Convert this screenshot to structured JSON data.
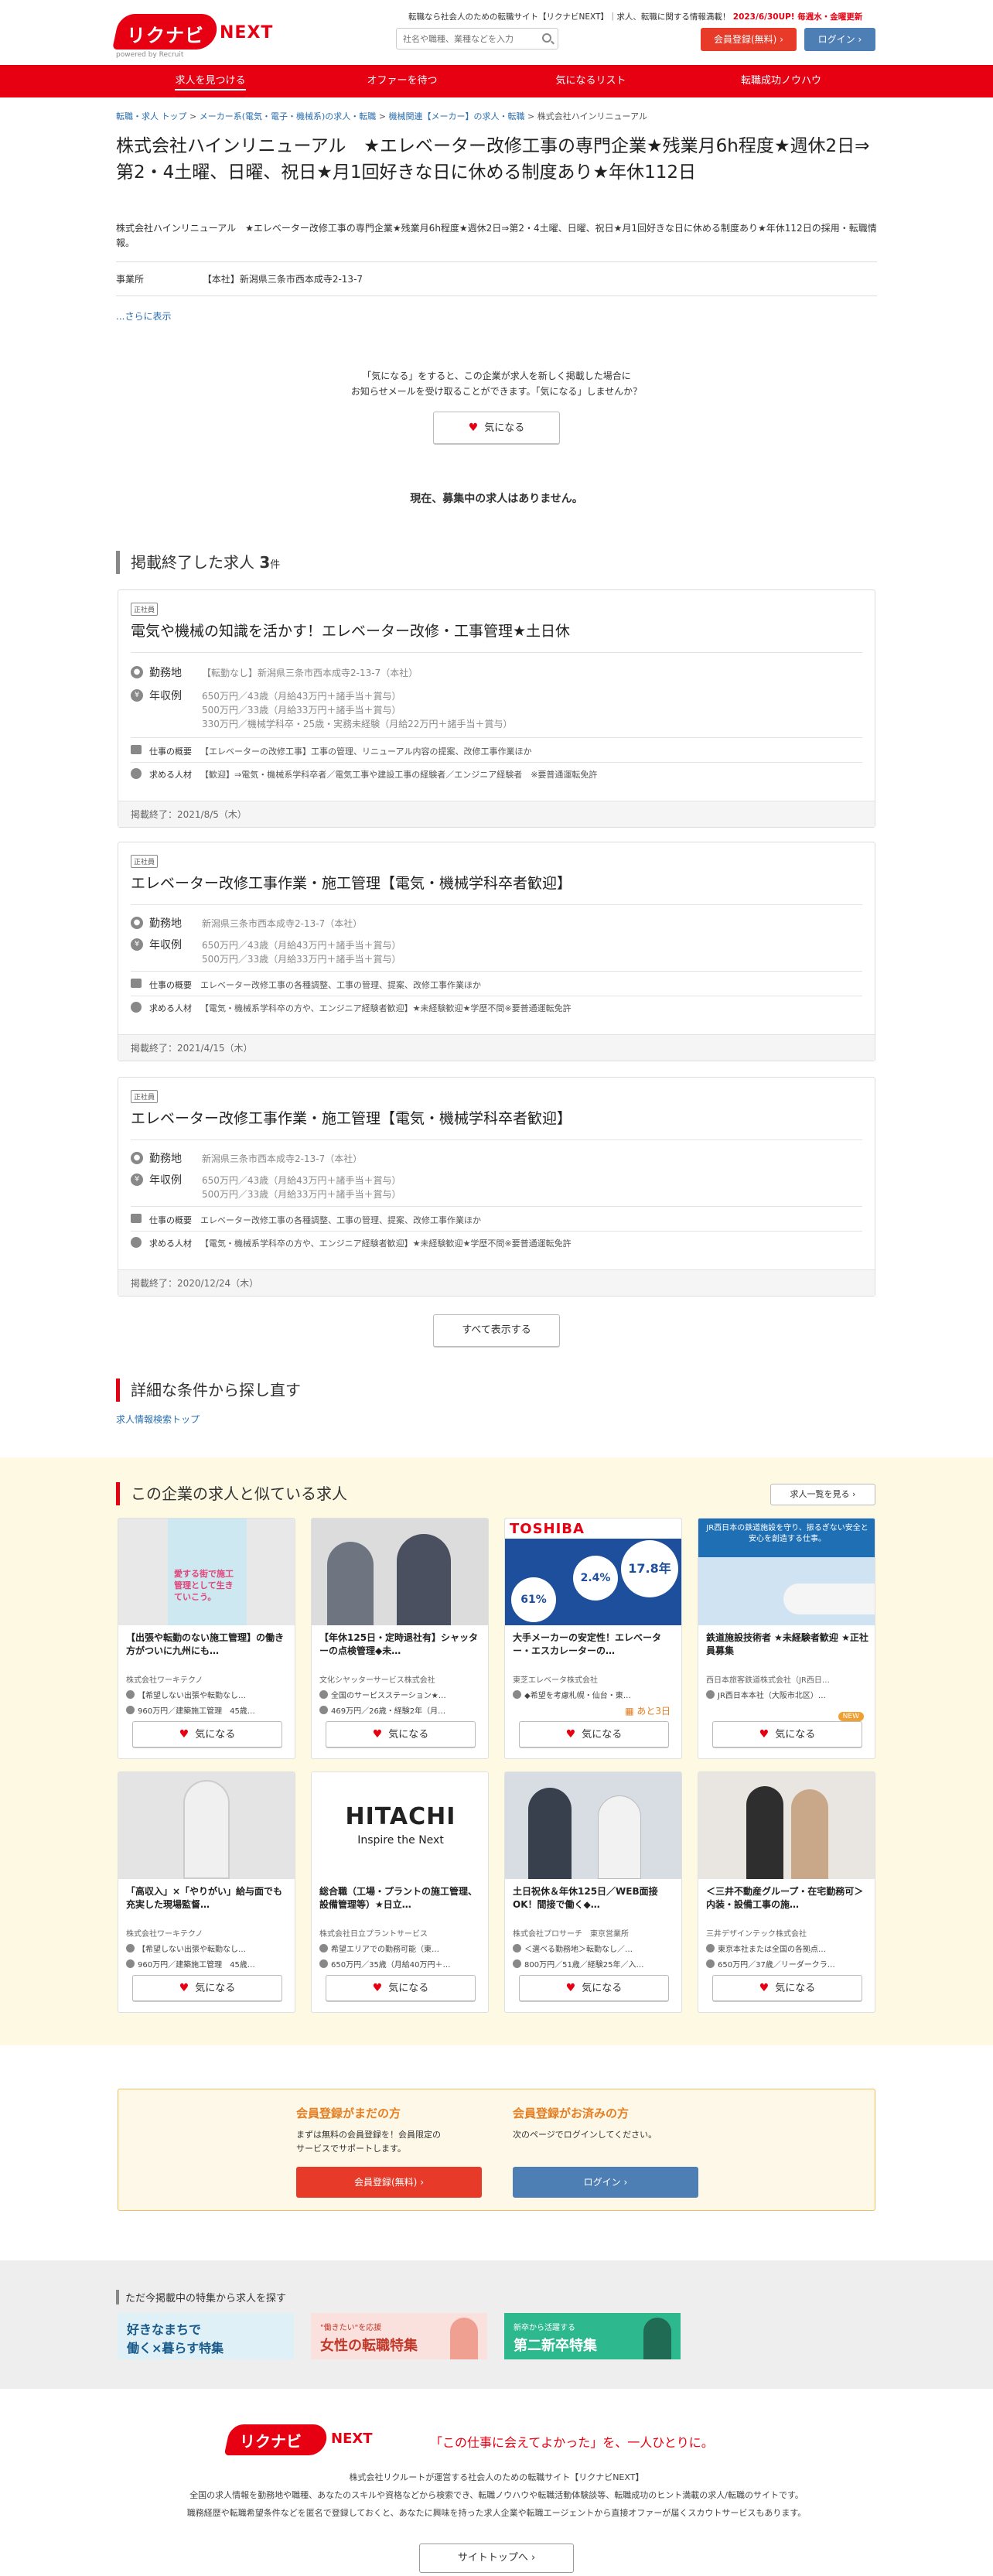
{
  "header": {
    "logo_text": "リクナビ",
    "logo_next": "NEXT",
    "logo_sub": "powered by Recruit",
    "tagline_1": "転職なら社会人のための転職サイト【リクナビNEXT】｜求人、転職に関する情報満載！",
    "tagline_2": "2023/6/30UP! 毎週水・金曜更新",
    "search_placeholder": "社名や職種、業種などを入力",
    "register_label": "会員登録(無料)",
    "login_label": "ログイン"
  },
  "nav": [
    "求人を見つける",
    "オファーを待つ",
    "気になるリスト",
    "転職成功ノウハウ"
  ],
  "breadcrumb": [
    "転職・求人 トップ",
    "メーカー系(電気・電子・機械系)の求人・転職",
    "機械関連【メーカー】の求人・転職",
    "株式会社ハインリニューアル"
  ],
  "company": {
    "title": "株式会社ハインリニューアル　★エレベーター改修工事の専門企業★残業月6h程度★週休2日⇒第2・4土曜、日曜、祝日★月1回好きな日に休める制度あり★年休112日",
    "sub": "株式会社ハインリニューアル　★エレベーター改修工事の専門企業★残業月6h程度★週休2日⇒第2・4土曜、日曜、祝日★月1回好きな日に休める制度あり★年休112日の採用・転職情報。",
    "office_label": "事業所",
    "office_value": "【本社】新潟県三条市西本成寺2-13-7",
    "more": "...さらに表示"
  },
  "favorite": {
    "note_1": "「気になる」をすると、この企業が求人を新しく掲載した場合に",
    "note_2": "お知らせメールを受け取ることができます。「気になる」しませんか？",
    "button": "気になる",
    "no_jobs": "現在、募集中の求人はありません。"
  },
  "ended": {
    "heading": "掲載終了した求人",
    "count": "3",
    "count_unit": "件",
    "labels": {
      "location": "勤務地",
      "salary": "年収例",
      "work": "仕事の概要",
      "want": "求める人材"
    },
    "jobs": [
      {
        "tag": "正社員",
        "title": "電気や機械の知識を活かす！エレベーター改修・工事管理★土日休",
        "location": "【転勤なし】新潟県三条市西本成寺2-13-7（本社）",
        "salary": [
          "650万円／43歳（月給43万円＋諸手当＋賞与）",
          "500万円／33歳（月給33万円＋諸手当＋賞与）",
          "330万円／機械学科卒・25歳・実務未経験（月給22万円＋諸手当＋賞与）"
        ],
        "work": "【エレベーターの改修工事】工事の管理、リニューアル内容の提案、改修工事作業ほか",
        "want": "【歓迎】⇒電気・機械系学科卒者／電気工事や建設工事の経験者／エンジニア経験者　※要普通運転免許",
        "ended": "掲載終了：2021/8/5（木）"
      },
      {
        "tag": "正社員",
        "title": "エレベーター改修工事作業・施工管理【電気・機械学科卒者歓迎】",
        "location": "新潟県三条市西本成寺2-13-7（本社）",
        "salary": [
          "650万円／43歳（月給43万円＋諸手当＋賞与）",
          "500万円／33歳（月給33万円＋諸手当＋賞与）"
        ],
        "work": "エレベーター改修工事の各種調整、工事の管理、提案、改修工事作業ほか",
        "want": "【電気・機械系学科卒の方や、エンジニア経験者歓迎】★未経験歓迎★学歴不問※要普通運転免許",
        "ended": "掲載終了：2021/4/15（木）"
      },
      {
        "tag": "正社員",
        "title": "エレベーター改修工事作業・施工管理【電気・機械学科卒者歓迎】",
        "location": "新潟県三条市西本成寺2-13-7（本社）",
        "salary": [
          "650万円／43歳（月給43万円＋諸手当＋賞与）",
          "500万円／33歳（月給33万円＋諸手当＋賞与）"
        ],
        "work": "エレベーター改修工事の各種調整、工事の管理、提案、改修工事作業ほか",
        "want": "【電気・機械系学科卒の方や、エンジニア経験者歓迎】★未経験歓迎★学歴不問※要普通運転免許",
        "ended": "掲載終了：2020/12/24（木）"
      }
    ],
    "show_all": "すべて表示する"
  },
  "search_again": {
    "heading": "詳細な条件から探し直す",
    "link": "求人情報検索トップ"
  },
  "similar": {
    "heading": "この企業の求人と似ている求人",
    "list_button": "求人一覧を見る",
    "fav": "気になる",
    "items": [
      {
        "title": "【出張や転勤のない施工管理】の働き方がついに九州にも…",
        "company": "株式会社ワーキテクノ",
        "location": "【希望しない出張や転勤なし…",
        "salary": "960万円／建築施工管理　45歳…",
        "img_text": "愛する街で施工管理として生きていこう。"
      },
      {
        "title": "【年休125日・定時退社有】シャッターの点検管理◆未…",
        "company": "文化シヤッターサービス株式会社",
        "location": "全国のサービスステーション★…",
        "salary": "469万円／26歳・経験2年（月…"
      },
      {
        "title": "大手メーカーの安定性！エレベーター・エスカレーターの…",
        "company": "東芝エレベータ株式会社",
        "location": "◆希望を考慮札幌・仙台・東…",
        "salary": "",
        "days": "あと3日",
        "img_text": "TOSHIBA",
        "stat1": "17.8年",
        "stat2": "2.4%",
        "stat3": "61%"
      },
      {
        "title": "鉄道施設技術者 ★未経験者歓迎 ★正社員募集",
        "company": "西日本旅客鉄道株式会社（JR西日…",
        "location": "JR西日本本社（大阪市北区）…",
        "salary": "",
        "new": "NEW",
        "img_text": "JR西日本の鉄道施設を守り、振るぎない安全と安心を創造する仕事。"
      },
      {
        "title": "「高収入」×「やりがい」給与面でも充実した現場監督…",
        "company": "株式会社ワーキテクノ",
        "location": "【希望しない出張や転勤なし…",
        "salary": "960万円／建築施工管理　45歳…"
      },
      {
        "title": "総合職（工場・プラントの施工管理、設備管理等）★日立…",
        "company": "株式会社日立プラントサービス",
        "location": "希望エリアでの勤務可能（東…",
        "salary": "650万円／35歳（月給40万円＋…",
        "img_text": "HITACHI",
        "img_sub": "Inspire the Next"
      },
      {
        "title": "土日祝休＆年休125日／WEB面接OK！間接で働く◆…",
        "company": "株式会社プロサーチ　東京営業所",
        "location": "＜選べる勤務地＞転勤なし／…",
        "salary": "800万円／51歳／経験25年／入…"
      },
      {
        "title": "＜三井不動産グループ・在宅勤務可＞内装・設備工事の施…",
        "company": "三井デザインテック株式会社",
        "location": "東京本社または全国の各拠点…",
        "salary": "650万円／37歳／リーダークラ…"
      }
    ]
  },
  "member": {
    "left_heading": "会員登録がまだの方",
    "left_text_1": "まずは無料の会員登録を！会員限定の",
    "left_text_2": "サービスでサポートします。",
    "right_heading": "会員登録がお済みの方",
    "right_text": "次のページでログインしてください。",
    "register": "会員登録(無料)",
    "login": "ログイン"
  },
  "features": {
    "heading": "ただ今掲載中の特集から求人を探す",
    "banners": [
      {
        "line1": "好きなまちで",
        "line2": "働く×暮らす特集",
        "color": "#dff0f7",
        "fg": "#1a5a8a"
      },
      {
        "line1": "\"働きたい\"を応援",
        "line2": "女性の転職特集",
        "color": "#fbe1de",
        "fg": "#c0392b"
      },
      {
        "line1": "新卒から活躍する",
        "line2": "第二新卒特集",
        "color": "#2eb88e",
        "fg": "#ffffff"
      }
    ]
  },
  "footer": {
    "logo_text": "リクナビ",
    "logo_next": "NEXT",
    "copy": "「この仕事に会えてよかった」を、一人ひとりに。",
    "line1": "株式会社リクルートが運営する社会人のための転職サイト【リクナビNEXT】",
    "line2": "全国の求人情報を勤務地や職種、あなたのスキルや資格などから検索でき、転職ノウハウや転職活動体験談等、転職成功のヒント満載の求人/転職のサイトです。",
    "line3": "職務経歴や転職希望条件などを匿名で登録しておくと、あなたに興味を持った求人企業や転職エージェントから直接オファーが届くスカウトサービスもあります。",
    "top_button": "サイトトップへ"
  }
}
